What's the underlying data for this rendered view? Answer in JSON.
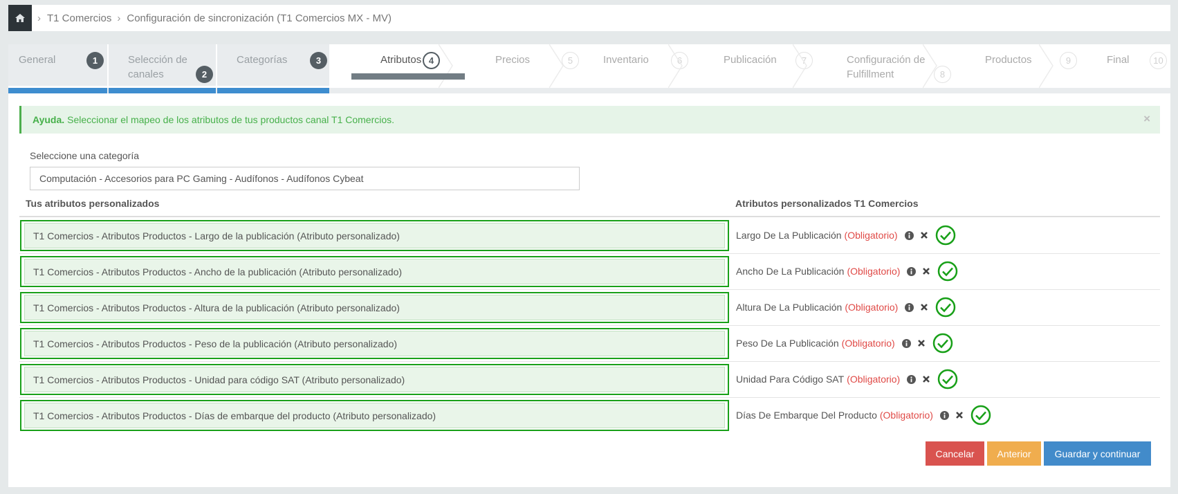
{
  "breadcrumb": {
    "home_icon": "home-icon",
    "items": [
      "T1 Comercios",
      "Configuración de sincronización (T1 Comercios MX - MV)"
    ]
  },
  "wizard": {
    "steps": [
      {
        "label": "General",
        "number": "1",
        "state": "done"
      },
      {
        "label": "Selección de canales",
        "number": "2",
        "state": "done"
      },
      {
        "label": "Categorías",
        "number": "3",
        "state": "done"
      },
      {
        "label": "Atributos",
        "number": "4",
        "state": "active"
      },
      {
        "label": "Precios",
        "number": "5",
        "state": "future"
      },
      {
        "label": "Inventario",
        "number": "6",
        "state": "future"
      },
      {
        "label": "Publicación",
        "number": "7",
        "state": "future"
      },
      {
        "label": "Configuración de Fulfillment",
        "number": "8",
        "state": "future"
      },
      {
        "label": "Productos",
        "number": "9",
        "state": "future"
      },
      {
        "label": "Final",
        "number": "10",
        "state": "future"
      }
    ]
  },
  "alert": {
    "title": "Ayuda.",
    "text": "Seleccionar el mapeo de los atributos de tus productos canal T1 Comercios.",
    "close": "×"
  },
  "category": {
    "label": "Seleccione una categoría",
    "value": "Computación - Accesorios para PC Gaming - Audífonos - Audífonos Cybeat"
  },
  "mapping": {
    "left_header": "Tus atributos personalizados",
    "right_header": "Atributos personalizados T1 Comercios",
    "required_label": "(Obligatorio)",
    "rows": [
      {
        "custom": "T1 Comercios - Atributos Productos - Largo de la publicación (Atributo personalizado)",
        "channel": "Largo De La Publicación"
      },
      {
        "custom": "T1 Comercios - Atributos Productos - Ancho de la publicación (Atributo personalizado)",
        "channel": "Ancho De La Publicación"
      },
      {
        "custom": "T1 Comercios - Atributos Productos - Altura de la publicación (Atributo personalizado)",
        "channel": "Altura De La Publicación"
      },
      {
        "custom": "T1 Comercios - Atributos Productos - Peso de la publicación (Atributo personalizado)",
        "channel": "Peso De La Publicación"
      },
      {
        "custom": "T1 Comercios - Atributos Productos - Unidad para código SAT (Atributo personalizado)",
        "channel": "Unidad Para Código SAT"
      },
      {
        "custom": "T1 Comercios - Atributos Productos - Días de embarque del producto (Atributo personalizado)",
        "channel": "Días De Embarque Del Producto"
      }
    ]
  },
  "buttons": {
    "cancel": "Cancelar",
    "previous": "Anterior",
    "save": "Guardar y continuar"
  },
  "colors": {
    "success": "#18a018",
    "required": "#e04a47",
    "progress": "#3e8dcf",
    "cancel": "#d9534f",
    "previous": "#f0ad4e",
    "save": "#428bca"
  }
}
